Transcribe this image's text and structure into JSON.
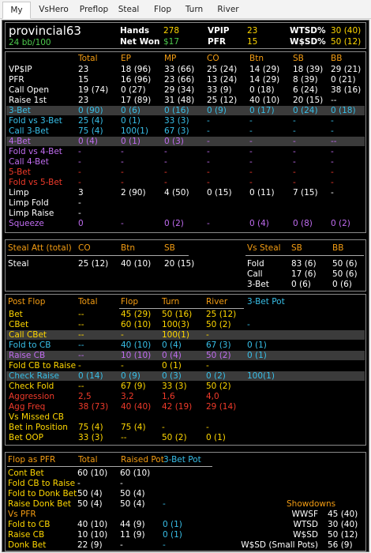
{
  "tabs": [
    "My",
    "VsHero",
    "Preflop",
    "Steal",
    "Flop",
    "Turn",
    "River"
  ],
  "player": {
    "name": "provincial63",
    "stack": "24 bb/100",
    "hands_label": "Hands",
    "hands": "278",
    "netwon_label": "Net Won",
    "netwon": "$17",
    "vpip_label": "VPIP",
    "vpip": "23",
    "pfr_label": "PFR",
    "pfr": "15",
    "wtsd_label": "WTSD%",
    "wtsd": "30 (40)",
    "wsd_label": "W$SD%",
    "wsd": "50 (12)"
  },
  "preflop": {
    "headers": [
      "Total",
      "EP",
      "MP",
      "CO",
      "Btn",
      "SB",
      "BB"
    ],
    "rows": [
      {
        "label": "VP$IP",
        "cells": [
          "23",
          "18 (96)",
          "33 (66)",
          "25 (24)",
          "14 (29)",
          "18 (39)",
          "29 (21)"
        ]
      },
      {
        "label": "PFR",
        "cells": [
          "15",
          "16 (96)",
          "23 (66)",
          "13 (24)",
          "14 (29)",
          "8 (39)",
          "0 (21)"
        ]
      },
      {
        "label": "Call Open",
        "cells": [
          "19 (74)",
          "0 (27)",
          "29 (34)",
          "33 (9)",
          "0 (18)",
          "6 (24)",
          "38 (16)"
        ]
      },
      {
        "label": "Raise 1st",
        "cells": [
          "23",
          "17 (89)",
          "31 (48)",
          "25 (12)",
          "40 (10)",
          "20 (15)",
          "--"
        ]
      },
      {
        "label": "3-Bet",
        "cells": [
          "0 (90)",
          "0 (6)",
          "0 (16)",
          "0 (9)",
          "0 (17)",
          "0 (24)",
          "0 (18)"
        ]
      },
      {
        "label": "Fold vs 3-Bet",
        "cells": [
          "25 (4)",
          "0 (1)",
          "33 (3)",
          "-",
          "-",
          "-",
          "-"
        ]
      },
      {
        "label": "Call 3-Bet",
        "cells": [
          "75 (4)",
          "100(1)",
          "67 (3)",
          "-",
          "-",
          "-",
          "-"
        ]
      },
      {
        "label": "4-Bet",
        "cells": [
          "0 (4)",
          "0 (1)",
          "0 (3)",
          "-",
          "-",
          "-",
          "--"
        ]
      },
      {
        "label": "Fold vs 4-Bet",
        "cells": [
          "-",
          "-",
          "-",
          "-",
          "-",
          "-",
          "-"
        ]
      },
      {
        "label": "Call 4-Bet",
        "cells": [
          "-",
          "-",
          "-",
          "-",
          "-",
          "-",
          "-"
        ]
      },
      {
        "label": "5-Bet",
        "cells": [
          "-",
          "-",
          "-",
          "-",
          "-",
          "-",
          "-"
        ]
      },
      {
        "label": "Fold vs 5-Bet",
        "cells": [
          "-",
          "-",
          "-",
          "-",
          "-",
          "-",
          "-"
        ]
      },
      {
        "label": "Limp",
        "cells": [
          "3",
          "2 (90)",
          "4 (50)",
          "0 (15)",
          "0 (11)",
          "7 (15)",
          "-"
        ]
      },
      {
        "label": "Limp Fold",
        "cells": [
          "-",
          "",
          "",
          "",
          "",
          "",
          ""
        ]
      },
      {
        "label": "Limp Raise",
        "cells": [
          "-",
          "",
          "",
          "",
          "",
          "",
          ""
        ]
      },
      {
        "label": "Squeeze",
        "cells": [
          "0",
          "-",
          "0 (2)",
          "-",
          "0 (4)",
          "0 (8)",
          "0 (2)"
        ]
      }
    ]
  },
  "steal": {
    "att_label": "Steal Att (total)",
    "att_headers": [
      "CO",
      "Btn",
      "SB"
    ],
    "steal_label": "Steal",
    "steal_cells": [
      "25 (12)",
      "40 (10)",
      "20 (15)"
    ],
    "vs_label": "Vs Steal",
    "vs_headers": [
      "SB",
      "BB"
    ],
    "vs_rows": [
      {
        "label": "Fold",
        "cells": [
          "83 (6)",
          "50 (6)"
        ]
      },
      {
        "label": "Call",
        "cells": [
          "17 (6)",
          "50 (6)"
        ]
      },
      {
        "label": "3-Bet",
        "cells": [
          "0 (6)",
          "0 (6)"
        ]
      }
    ]
  },
  "postflop": {
    "title": "Post Flop",
    "headers": [
      "Total",
      "Flop",
      "Turn",
      "River",
      "3-Bet Pot"
    ],
    "rows": [
      {
        "label": "Bet",
        "cells": [
          "--",
          "45 (29)",
          "50 (16)",
          "25 (12)",
          ""
        ]
      },
      {
        "label": "CBet",
        "cells": [
          "--",
          "60 (10)",
          "100(3)",
          "50 (2)",
          "-"
        ]
      },
      {
        "label": "Call CBet",
        "cells": [
          "--",
          "-",
          "100(1)",
          "-",
          ""
        ]
      },
      {
        "label": "Fold to CB",
        "cells": [
          "--",
          "40 (10)",
          "0 (4)",
          "67 (3)",
          "0 (1)"
        ]
      },
      {
        "label": "Raise CB",
        "cells": [
          "--",
          "10 (10)",
          "0 (4)",
          "50 (2)",
          "0 (1)"
        ]
      },
      {
        "label": "Fold CB to Raise",
        "cells": [
          "-",
          "-",
          "0 (1)",
          "-",
          ""
        ]
      },
      {
        "label": "Check Raise",
        "cells": [
          "0 (14)",
          "0 (9)",
          "0 (3)",
          "0 (2)",
          "100(1)"
        ]
      },
      {
        "label": "Check Fold",
        "cells": [
          "--",
          "67 (9)",
          "33 (3)",
          "50 (2)",
          ""
        ]
      },
      {
        "label": "Aggression",
        "cells": [
          "2,5",
          "3,2",
          "1,6",
          "4,0",
          ""
        ]
      },
      {
        "label": "Agg Freq",
        "cells": [
          "38 (73)",
          "40 (40)",
          "42 (19)",
          "29 (14)",
          ""
        ]
      },
      {
        "label": "Vs Missed CB",
        "cells": [
          "",
          "",
          "",
          "",
          ""
        ]
      },
      {
        "label": "Bet in Position",
        "cells": [
          "75 (4)",
          "75 (4)",
          "-",
          "-",
          ""
        ]
      },
      {
        "label": "Bet OOP",
        "cells": [
          "33 (3)",
          "--",
          "50 (2)",
          "0 (1)",
          ""
        ]
      }
    ]
  },
  "pfr_block": {
    "title": "Flop as PFR",
    "headers": [
      "Total",
      "Raised Pot",
      "3-Bet Pot"
    ],
    "rows": [
      {
        "label": "Cont Bet",
        "cells": [
          "60 (10)",
          "60 (10)",
          ""
        ]
      },
      {
        "label": "Fold CB to Raise",
        "cells": [
          "-",
          "-",
          ""
        ]
      },
      {
        "label": "Fold to Donk Bet",
        "cells": [
          "50 (4)",
          "50 (4)",
          ""
        ]
      },
      {
        "label": "Raise Donk Bet",
        "cells": [
          "50 (4)",
          "50 (4)",
          "-"
        ]
      },
      {
        "label": "Vs PFR",
        "cells": [
          "",
          "",
          ""
        ]
      },
      {
        "label": "Fold to CB",
        "cells": [
          "40 (10)",
          "44 (9)",
          "0 (1)"
        ]
      },
      {
        "label": "Raise CB",
        "cells": [
          "10 (10)",
          "11 (9)",
          "0 (1)"
        ]
      },
      {
        "label": "Donk Bet",
        "cells": [
          "22 (9)",
          "-",
          "-"
        ]
      }
    ],
    "showdowns_title": "Showdowns",
    "showdowns": [
      {
        "label": "WWSF",
        "value": "45 (40)"
      },
      {
        "label": "WTSD",
        "value": "30 (40)"
      },
      {
        "label": "W$SD",
        "value": "50 (12)"
      },
      {
        "label": "W$SD (Small Pots)",
        "value": "56 (9)"
      }
    ]
  },
  "colors": {
    "orange": "#f39c12",
    "yellow": "#ffd700",
    "green": "#4cc94c",
    "cyan": "#38bfe8",
    "purple": "#c06cf0",
    "red": "#f03a2a",
    "gray_row": "#3b3b3b"
  }
}
